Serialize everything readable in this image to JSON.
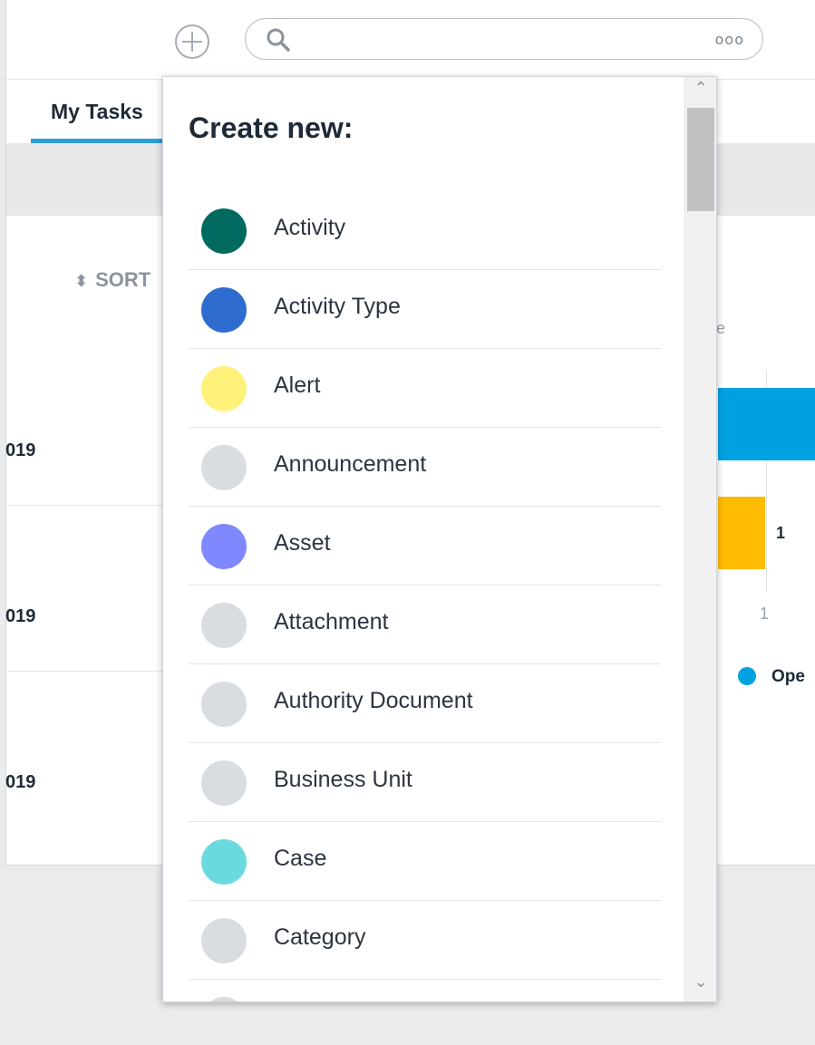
{
  "header": {
    "add_icon": "plus-circle-icon",
    "search": {
      "placeholder": "",
      "more_label": "ooo"
    }
  },
  "tabs": [
    {
      "label": "My Tasks",
      "active": true
    }
  ],
  "background": {
    "sort_label": "SORT",
    "row_dates": [
      "019",
      "019",
      "019"
    ],
    "axis_fragment": "e",
    "bar_value_label": "1",
    "axis_tick": "1",
    "legend_label": "Ope",
    "colors": {
      "bar_blue": "#00a1e0",
      "bar_yellow": "#ffbb00"
    }
  },
  "create_menu": {
    "title": "Create new:",
    "items": [
      {
        "label": "Activity",
        "color": "#006a60"
      },
      {
        "label": "Activity Type",
        "color": "#2f6ccf"
      },
      {
        "label": "Alert",
        "color": "#fff27a"
      },
      {
        "label": "Announcement",
        "color": "#d9dce0"
      },
      {
        "label": "Asset",
        "color": "#8088ff"
      },
      {
        "label": "Attachment",
        "color": "#d9dce0"
      },
      {
        "label": "Authority Document",
        "color": "#d9dce0"
      },
      {
        "label": "Business Unit",
        "color": "#d9dce0"
      },
      {
        "label": "Case",
        "color": "#6bdadf"
      },
      {
        "label": "Category",
        "color": "#d9dce0"
      }
    ]
  }
}
